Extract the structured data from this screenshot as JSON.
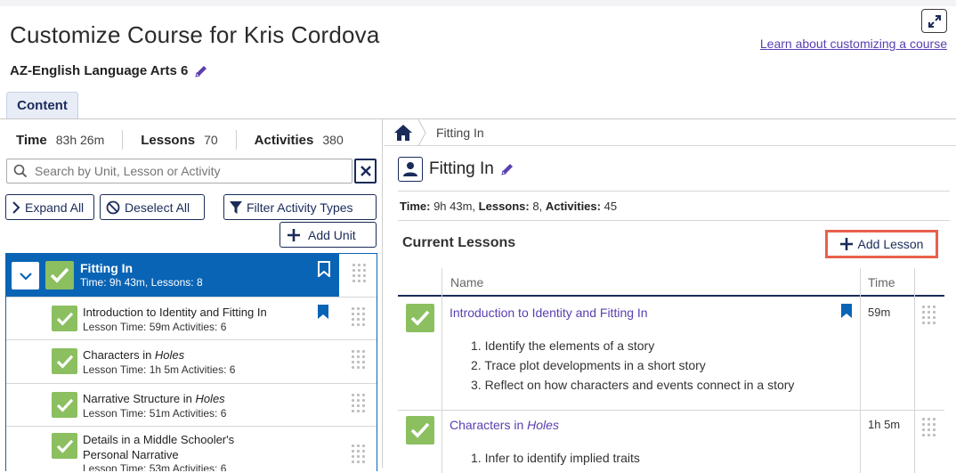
{
  "header": {
    "title": "Customize Course for Kris Cordova",
    "course_name": "AZ-English Language Arts 6",
    "learn_link": "Learn about customizing a course",
    "tab": "Content"
  },
  "left": {
    "stats": [
      {
        "label": "Time",
        "value": "83h 26m"
      },
      {
        "label": "Lessons",
        "value": "70"
      },
      {
        "label": "Activities",
        "value": "380"
      }
    ],
    "search_placeholder": "Search by Unit, Lesson or Activity",
    "expand_all": "Expand All",
    "deselect_all": "Deselect All",
    "filter_types": "Filter Activity Types",
    "add_unit": "Add Unit",
    "unit": {
      "title": "Fitting In",
      "sub": "Time: 9h 43m, Lessons: 8"
    },
    "lessons": [
      {
        "title": "Introduction to Identity and Fitting In",
        "title_italic": "",
        "title_2": "",
        "sub": "Lesson Time: 59m   Activities: 6"
      },
      {
        "title": "Characters in ",
        "title_italic": "Holes",
        "title_2": "",
        "sub": "Lesson Time: 1h 5m   Activities: 6"
      },
      {
        "title": "Narrative Structure in ",
        "title_italic": "Holes",
        "title_2": "",
        "sub": "Lesson Time: 51m   Activities: 6"
      },
      {
        "title": "Details in a Middle Schooler's",
        "title_italic": "",
        "title_2": "Personal Narrative",
        "sub": "Lesson Time: 53m   Activities: 6"
      }
    ]
  },
  "right": {
    "breadcrumb": "Fitting In",
    "unit_name": "Fitting In",
    "meta": {
      "time_label": "Time:",
      "time": "9h 43m,",
      "lessons_label": "Lessons:",
      "lessons": "8,",
      "activities_label": "Activities:",
      "activities": "45"
    },
    "current_lessons": "Current Lessons",
    "add_lesson": "Add Lesson",
    "columns": {
      "name": "Name",
      "time": "Time"
    },
    "rows": [
      {
        "title": "Introduction to Identity and Fitting In",
        "title_italic": "",
        "time": "59m",
        "objectives": [
          "1. Identify the elements of a story",
          "2. Trace plot developments in a short story",
          "3. Reflect on how characters and events connect in a story"
        ]
      },
      {
        "title": "Characters in ",
        "title_italic": "Holes",
        "time": "1h 5m",
        "objectives": [
          "1. Infer to identify implied traits"
        ]
      }
    ]
  },
  "colors": {
    "primary": "#0a64b5",
    "navy": "#1a2b5a",
    "check_green": "#8bbf5f",
    "link_purple": "#5a3fb0",
    "highlight": "#e8604c"
  }
}
